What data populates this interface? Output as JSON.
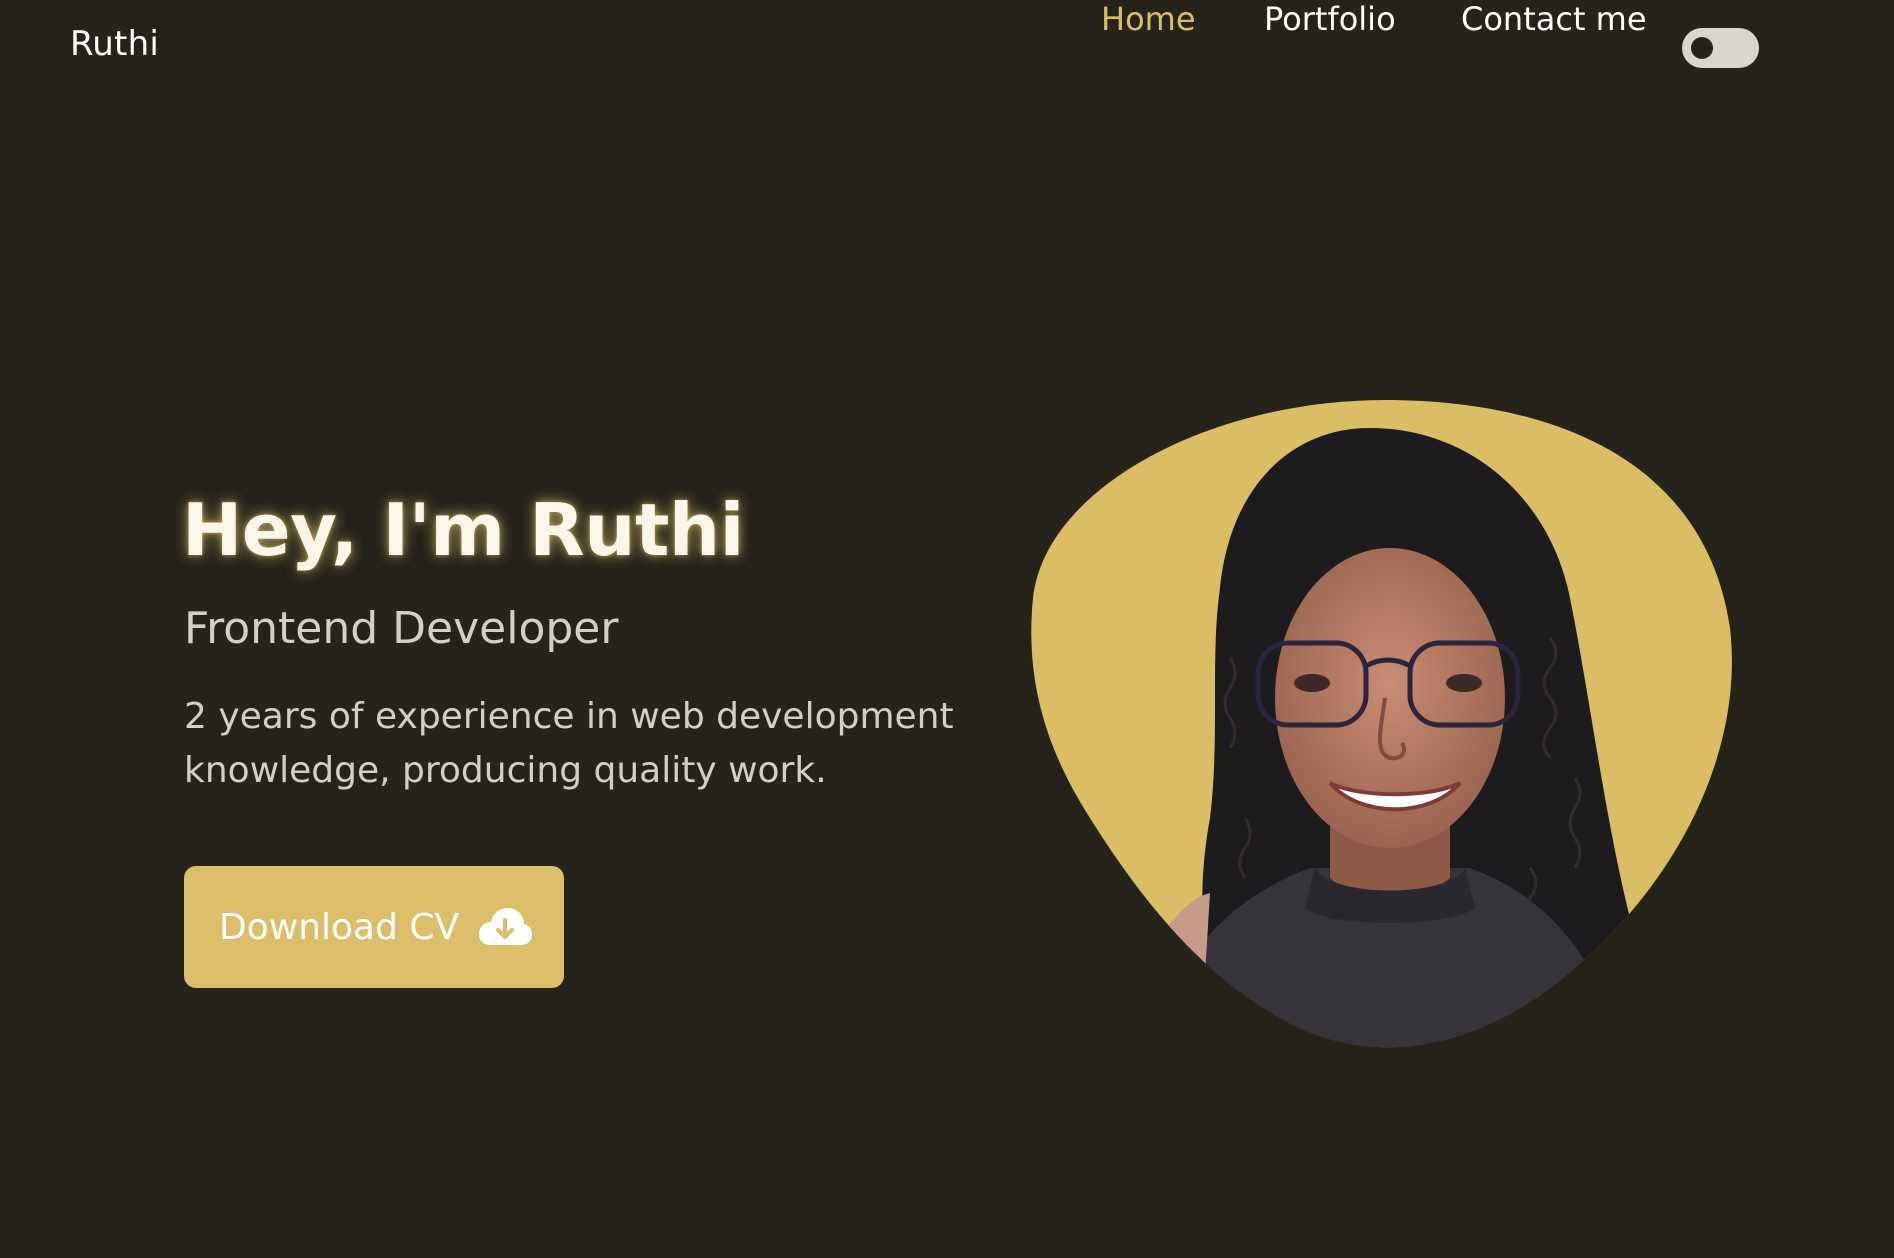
{
  "header": {
    "brand": "Ruthi",
    "nav": [
      {
        "label": "Home",
        "active": true
      },
      {
        "label": "Portfolio",
        "active": false
      },
      {
        "label": "Contact me",
        "active": false
      }
    ],
    "theme_toggle": {
      "state": "off"
    }
  },
  "hero": {
    "title": "Hey, I'm Ruthi",
    "subtitle": "Frontend Developer",
    "description": "2 years of experience in web development knowledge, producing quality work.",
    "cta_label": "Download CV",
    "cta_icon": "cloud-download-icon"
  },
  "colors": {
    "background": "#25231a",
    "accent": "#dbbd6a",
    "text": "#ffffff",
    "muted_text": "#d2cfc7"
  }
}
